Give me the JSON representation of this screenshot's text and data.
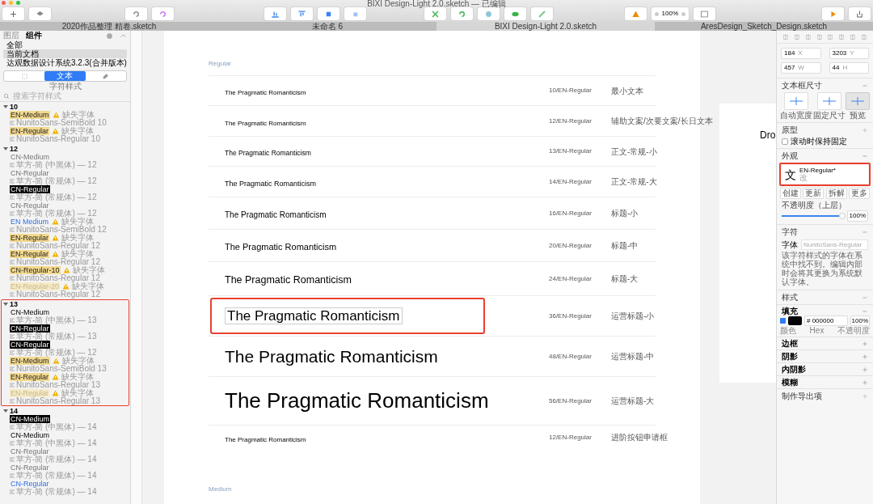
{
  "window": {
    "title": "BIXI Design-Light 2.0.sketch — 已编辑",
    "zoom": "100%"
  },
  "doc_tabs": [
    {
      "label": "2020作品整理 精卷.sketch",
      "selected": false
    },
    {
      "label": "未命名 6",
      "selected": false
    },
    {
      "label": "BIXI Design-Light 2.0.sketch",
      "selected": true
    },
    {
      "label": "AresDesign_Sketch_Design.sketch",
      "selected": false
    }
  ],
  "sidebar": {
    "tabs": [
      {
        "label": "图层",
        "selected": false
      },
      {
        "label": "组件",
        "selected": true
      }
    ],
    "sources": [
      {
        "label": "全部",
        "selected": false
      },
      {
        "label": "当前文档",
        "selected": true
      },
      {
        "label": "达观数据设计系统3.2.3(合并版本)",
        "selected": false
      }
    ],
    "segments": [
      {
        "kind": "symbol",
        "selected": false
      },
      {
        "kind": "text",
        "label": "文本",
        "selected": true
      },
      {
        "kind": "layer",
        "selected": false
      }
    ],
    "segment_caption": "字符样式",
    "search": {
      "placeholder": "搜索字符样式"
    },
    "groups": [
      {
        "label": "10",
        "expanded": true,
        "annotated": false,
        "items": [
          {
            "name": "EN-Medium",
            "kind": "tag",
            "sub": "NunitoSans-SemiBold 10",
            "warning": "缺失字体"
          },
          {
            "name": "EN-Regular",
            "kind": "tag",
            "sub": "NunitoSans-Regular 10",
            "warning": "缺失字体"
          }
        ]
      },
      {
        "label": "12",
        "expanded": true,
        "annotated": false,
        "items": [
          {
            "name": "CN-Medium",
            "kind": "plain",
            "sub": "苹方-简 (中黑体) — 12"
          },
          {
            "name": "CN-Regular",
            "kind": "plain",
            "sub": "苹方-简 (常规体) — 12"
          },
          {
            "name": "CN-Regular",
            "kind": "dark",
            "sub": "苹方-简 (常规体) — 12"
          },
          {
            "name": "CN-Regular",
            "kind": "plain",
            "sub": "苹方-简 (常规体) — 12"
          },
          {
            "name": "EN Medium",
            "kind": "blue",
            "sub": "NunitoSans-SemiBold 12",
            "warning": "缺失字体"
          },
          {
            "name": "EN-Regular",
            "kind": "tag",
            "sub": "NunitoSans-Regular 12",
            "warning": "缺失字体"
          },
          {
            "name": "EN-Regular",
            "kind": "tag",
            "sub": "NunitoSans-Regular 12",
            "warning": "缺失字体"
          },
          {
            "name": "CN-Regular-10",
            "kind": "tag",
            "sub": "NunitoSans-Regular 12",
            "warning": "缺失字体"
          },
          {
            "name": "EN-Regular-20",
            "kind": "faded",
            "sub": "NunitoSans-Regular 12",
            "warning": "缺失字体"
          }
        ]
      },
      {
        "label": "13",
        "expanded": true,
        "annotated": true,
        "items": [
          {
            "name": "CN-Medium",
            "kind": "strong",
            "sub": "苹方-简 (中黑体) — 13"
          },
          {
            "name": "CN-Regular",
            "kind": "dark",
            "sub": "苹方-简 (常规体) — 13"
          },
          {
            "name": "CN-Regular",
            "kind": "dark",
            "sub": "苹方-简 (常规体) — 12"
          },
          {
            "name": "EN-Medium",
            "kind": "tag",
            "sub": "NunitoSans-SemiBold 13",
            "warning": "缺失字体"
          },
          {
            "name": "EN-Regular",
            "kind": "tag",
            "sub": "NunitoSans-Regular 13",
            "warning": "缺失字体"
          },
          {
            "name": "EN-Regular",
            "kind": "faded",
            "sub": "NunitoSans-Regular 13",
            "warning": "缺失字体"
          }
        ]
      },
      {
        "label": "14",
        "expanded": true,
        "annotated": false,
        "items": [
          {
            "name": "CN-Medium",
            "kind": "dark",
            "sub": "苹方-简 (中黑体) — 14"
          },
          {
            "name": "CN-Medium",
            "kind": "strong",
            "sub": "苹方-简 (中黑体) — 14"
          },
          {
            "name": "CN-Regular",
            "kind": "plain",
            "sub": "苹方-简 (常规体) — 14"
          },
          {
            "name": "CN-Regular",
            "kind": "plain",
            "sub": "苹方-简 (常规体) — 14"
          },
          {
            "name": "CN-Regular",
            "kind": "blue",
            "sub": "苹方-简 (常规体) — 14"
          }
        ]
      }
    ]
  },
  "artboard": {
    "section": "Regular",
    "rows": [
      {
        "sample": "The Pragmatic Romanticism",
        "spec": "10/EN-Regular",
        "usage": "最小文本",
        "annotated": false
      },
      {
        "sample": "The Pragmatic Romanticism",
        "spec": "12/EN-Regular",
        "usage": "辅助文案/次要文案/长日文本",
        "annotated": false
      },
      {
        "sample": "The Pragmatic Romanticism",
        "spec": "13/EN-Regular",
        "usage": "正文-常规-小",
        "annotated": false
      },
      {
        "sample": "The Pragmatic Romanticism",
        "spec": "14/EN-Regular",
        "usage": "正文-常规-大",
        "annotated": false
      },
      {
        "sample": "The Pragmatic Romanticism",
        "spec": "16/EN-Regular",
        "usage": "标题-小",
        "annotated": false
      },
      {
        "sample": "The Pragmatic Romanticism",
        "spec": "20/EN-Regular",
        "usage": "标题-中",
        "annotated": false
      },
      {
        "sample": "The Pragmatic Romanticism",
        "spec": "24/EN-Regular",
        "usage": "标题-大",
        "annotated": false
      },
      {
        "sample": "The Pragmatic Romanticism",
        "spec": "36/EN-Regular",
        "usage": "运营标题-小",
        "annotated": true
      },
      {
        "sample": "The Pragmatic Romanticism",
        "spec": "48/EN-Regular",
        "usage": "运营标题-中",
        "annotated": false
      },
      {
        "sample": "The Pragmatic Romanticism",
        "spec": "56/EN-Regular",
        "usage": "运营标题-大",
        "annotated": false
      },
      {
        "sample": "The Pragmatic Romanticism",
        "spec": "12/EN-Regular",
        "usage": "进阶按钮申请框",
        "annotated": false
      }
    ],
    "next_section": "Medium"
  },
  "second_artboard_text": "Dro",
  "inspector": {
    "position": [
      {
        "value": "184",
        "label": "X"
      },
      {
        "value": "3203",
        "label": "Y"
      },
      {
        "value": "457",
        "label": "W"
      },
      {
        "value": "44",
        "label": "H"
      }
    ],
    "resize_title": "文本框尺寸",
    "resize_options": [
      {
        "label": "自动宽度",
        "selected": false
      },
      {
        "label": "固定尺寸",
        "selected": false
      },
      {
        "label": "预览",
        "selected": true
      }
    ],
    "prototype_title": "原型",
    "fix_scroll": {
      "label": "滚动时保持固定",
      "checked": false
    },
    "appearance_title": "外观",
    "style": {
      "glyph": "文",
      "name": "EN-Regular*",
      "note": "改",
      "annotated": true
    },
    "style_actions": [
      "创建",
      "更新",
      "拆解",
      "更多"
    ],
    "opacity": {
      "label": "不透明度（上层）",
      "level": 1,
      "reading": "100%"
    },
    "text_title": "字符",
    "font_label": "字体",
    "font_value": "NunitoSans-Regular",
    "font_note": "该字符样式的字体在系统中找不到。编辑内部时会将其更换为系统默认字体。",
    "style_title": "样式",
    "fill": {
      "title": "填充",
      "checked": true,
      "color": "#000000",
      "hex": "# 000000",
      "opacity": "100%",
      "captions": [
        "颜色",
        "Hex",
        "不透明度"
      ]
    },
    "sections": [
      "边框",
      "阴影",
      "内阴影",
      "模糊"
    ],
    "export": "制作导出项"
  }
}
